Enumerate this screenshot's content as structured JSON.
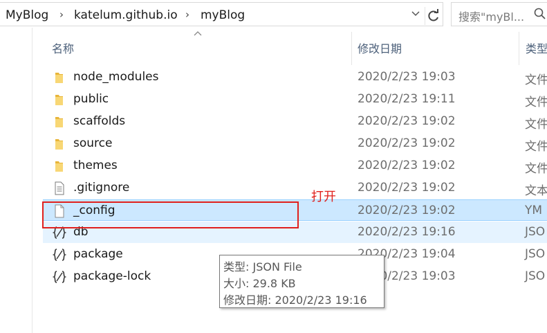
{
  "address": {
    "breadcrumbs": [
      "MyBlog",
      "katelum.github.io",
      "myBlog"
    ],
    "search_placeholder": "搜索\"myBl..."
  },
  "columns": {
    "name": "名称",
    "modified": "修改日期",
    "type": "类型"
  },
  "files": [
    {
      "name": "node_modules",
      "date": "2020/2/23 19:03",
      "type": "文件",
      "icon": "folder-icon",
      "state": ""
    },
    {
      "name": "public",
      "date": "2020/2/23 19:11",
      "type": "文件",
      "icon": "folder-icon",
      "state": ""
    },
    {
      "name": "scaffolds",
      "date": "2020/2/23 19:02",
      "type": "文件",
      "icon": "folder-icon",
      "state": ""
    },
    {
      "name": "source",
      "date": "2020/2/23 19:02",
      "type": "文件",
      "icon": "folder-icon",
      "state": ""
    },
    {
      "name": "themes",
      "date": "2020/2/23 19:02",
      "type": "文件",
      "icon": "folder-icon",
      "state": ""
    },
    {
      "name": ".gitignore",
      "date": "2020/2/23 19:02",
      "type": "文本",
      "icon": "text-file-icon",
      "state": ""
    },
    {
      "name": "_config",
      "date": "2020/2/23 19:02",
      "type": "YM",
      "icon": "blank-file-icon",
      "state": "selected"
    },
    {
      "name": "db",
      "date": "2020/2/23 19:16",
      "type": "JSO",
      "icon": "json-file-icon",
      "state": "hover"
    },
    {
      "name": "package",
      "date": "2020/2/23 19:04",
      "type": "JSO",
      "icon": "json-file-icon",
      "state": ""
    },
    {
      "name": "package-lock",
      "date": "2020/2/23 19:03",
      "type": "JSO",
      "icon": "json-file-icon",
      "state": ""
    }
  ],
  "annotation": {
    "label": "打开",
    "color": "#e0201c"
  },
  "tooltip": {
    "type_line": "类型: JSON File",
    "size_line": "大小: 29.8 KB",
    "date_line": "修改日期: 2020/2/23 19:16"
  },
  "colors": {
    "selected_bg": "#cce8ff",
    "hover_bg": "#e5f3ff",
    "folder": "#f8d775"
  }
}
